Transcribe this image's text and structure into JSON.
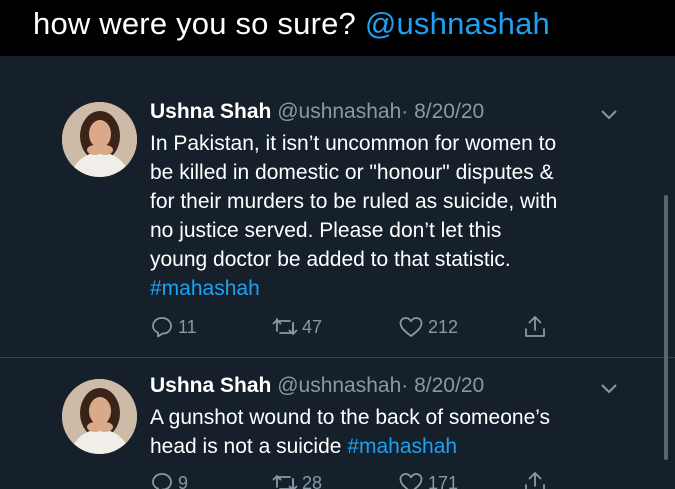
{
  "caption": {
    "text": "how were you so sure?",
    "mention": "@ushnashah"
  },
  "tweets": [
    {
      "display_name": "Ushna Shah",
      "handle": "@ushnashah",
      "date": "· 8/20/20",
      "lines": [
        "In Pakistan, it isn’t uncommon for women to",
        "be killed in domestic or \"honour\" disputes &",
        "for their murders to be ruled as suicide, with",
        "no justice served. Please don’t let this",
        "young doctor be added to that statistic."
      ],
      "hashtag": "#mahashah",
      "replies": "11",
      "retweets": "47",
      "likes": "212"
    },
    {
      "display_name": "Ushna Shah",
      "handle": "@ushnashah",
      "date": "· 8/20/20",
      "lines": [
        "A gunshot wound to the back of someone’s",
        "head is not a suicide"
      ],
      "hashtag": "#mahashah",
      "replies": "9",
      "retweets": "28",
      "likes": "171"
    }
  ],
  "colors": {
    "accent": "#1da1f2",
    "background": "#15202b",
    "muted": "#8899a6"
  },
  "icons": [
    "reply-icon",
    "retweet-icon",
    "like-icon",
    "share-icon",
    "chevron-down-icon"
  ]
}
